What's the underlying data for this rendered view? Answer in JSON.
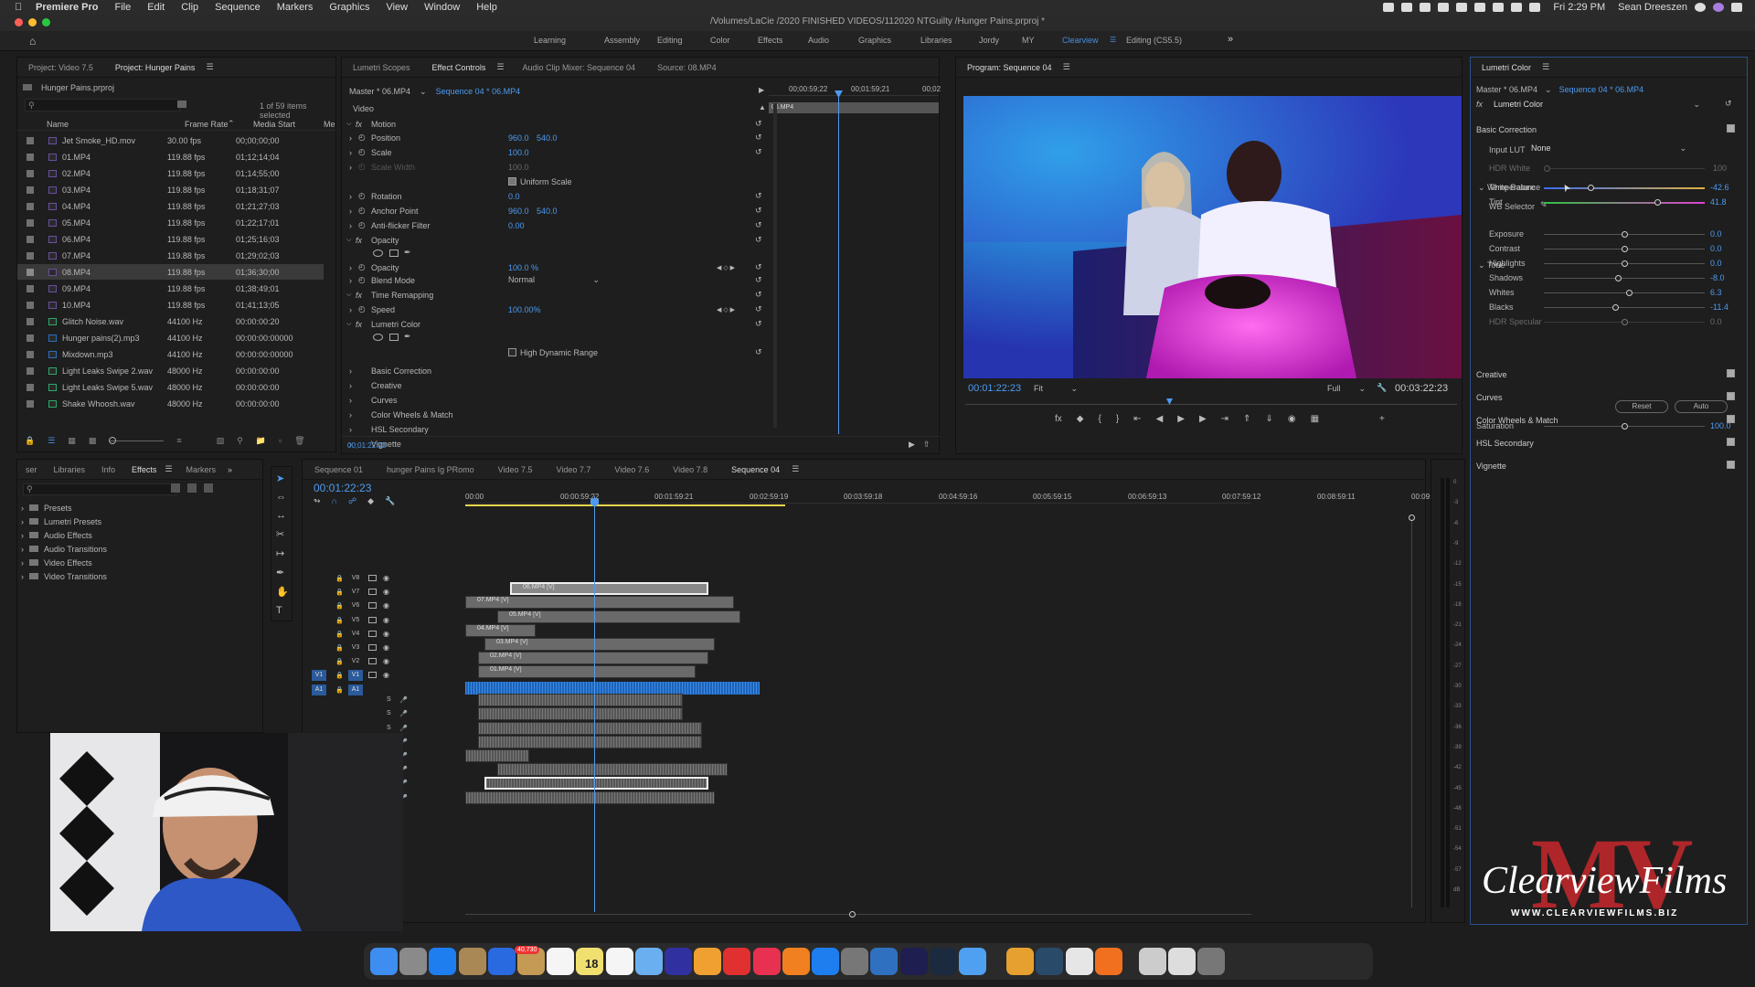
{
  "menubar": {
    "app": "Premiere Pro",
    "items": [
      "File",
      "Edit",
      "Clip",
      "Sequence",
      "Markers",
      "Graphics",
      "View",
      "Window",
      "Help"
    ],
    "clock": "Fri 2:29 PM",
    "user": "Sean Dreeszen"
  },
  "window": {
    "path": "/Volumes/LaCie /2020 FINISHED VIDEOS/112020 NTGuilty /Hunger Pains.prproj *"
  },
  "workspaces": [
    "Learning",
    "Assembly",
    "Editing",
    "Color",
    "Effects",
    "Audio",
    "Graphics",
    "Libraries",
    "Jordy",
    "MY",
    "Clearview",
    "Editing (CS5.5)"
  ],
  "workspace_active": "Clearview",
  "project": {
    "tabs": [
      "Project: Video 7.5",
      "Project: Hunger Pains"
    ],
    "file": "Hunger Pains.prproj",
    "selection": "1 of 59 items selected",
    "columns": [
      "Name",
      "Frame Rate",
      "Media Start",
      "Me"
    ],
    "items": [
      {
        "name": "Jet Smoke_HD.mov",
        "rate": "30.00 fps",
        "start": "00;00;00;00",
        "color": "#6a4fa0"
      },
      {
        "name": "01.MP4",
        "rate": "119.88 fps",
        "start": "01;12;14;04",
        "color": "#6a4fa0"
      },
      {
        "name": "02.MP4",
        "rate": "119.88 fps",
        "start": "01;14;55;00",
        "color": "#6a4fa0"
      },
      {
        "name": "03.MP4",
        "rate": "119.88 fps",
        "start": "01;18;31;07",
        "color": "#6a4fa0"
      },
      {
        "name": "04.MP4",
        "rate": "119.88 fps",
        "start": "01;21;27;03",
        "color": "#6a4fa0"
      },
      {
        "name": "05.MP4",
        "rate": "119.88 fps",
        "start": "01;22;17;01",
        "color": "#6a4fa0"
      },
      {
        "name": "06.MP4",
        "rate": "119.88 fps",
        "start": "01;25;16;03",
        "color": "#6a4fa0"
      },
      {
        "name": "07.MP4",
        "rate": "119.88 fps",
        "start": "01;29;02;03",
        "color": "#6a4fa0"
      },
      {
        "name": "08.MP4",
        "rate": "119.88 fps",
        "start": "01;36;30;00",
        "color": "#6a4fa0"
      },
      {
        "name": "09.MP4",
        "rate": "119.88 fps",
        "start": "01;38;49;01",
        "color": "#6a4fa0"
      },
      {
        "name": "10.MP4",
        "rate": "119.88 fps",
        "start": "01;41;13;05",
        "color": "#6a4fa0"
      },
      {
        "name": "Glitch Noise.wav",
        "rate": "44100 Hz",
        "start": "00:00:00:20",
        "color": "#2ea86a"
      },
      {
        "name": "Hunger pains(2).mp3",
        "rate": "44100 Hz",
        "start": "00:00:00:00000",
        "color": "#2a6fc0"
      },
      {
        "name": "Mixdown.mp3",
        "rate": "44100 Hz",
        "start": "00:00:00:00000",
        "color": "#2a6fc0"
      },
      {
        "name": "Light Leaks Swipe 2.wav",
        "rate": "48000 Hz",
        "start": "00:00:00:00",
        "color": "#2ea86a"
      },
      {
        "name": "Light Leaks Swipe 5.wav",
        "rate": "48000 Hz",
        "start": "00:00:00:00",
        "color": "#2ea86a"
      },
      {
        "name": "Shake Whoosh.wav",
        "rate": "48000 Hz",
        "start": "00:00:00:00",
        "color": "#2ea86a"
      }
    ]
  },
  "effect_controls": {
    "tabs": [
      "Lumetri Scopes",
      "Effect Controls",
      "Audio Clip Mixer: Sequence 04",
      "Source: 08.MP4"
    ],
    "master": "Master * 06.MP4",
    "sequence": "Sequence 04 * 06.MP4",
    "ruler": [
      "00;00:59;22",
      "00;01:59;21",
      "00;02"
    ],
    "clip_label": "06.MP4",
    "section_video": "Video",
    "rows": [
      {
        "label": "Motion",
        "value": "",
        "value2": "",
        "fx": true
      },
      {
        "label": "Position",
        "value": "960.0",
        "value2": "540.0"
      },
      {
        "label": "Scale",
        "value": "100.0",
        "value2": ""
      },
      {
        "label": "Scale Width",
        "value": "100.0",
        "value2": "",
        "dim": true
      },
      {
        "label": "Uniform Scale",
        "value": "",
        "value2": "",
        "check": true
      },
      {
        "label": "Rotation",
        "value": "0.0",
        "value2": ""
      },
      {
        "label": "Anchor Point",
        "value": "960.0",
        "value2": "540.0"
      },
      {
        "label": "Anti-flicker Filter",
        "value": "0.00",
        "value2": ""
      },
      {
        "label": "Opacity",
        "value": "",
        "value2": "",
        "fx": true
      },
      {
        "label": "",
        "value": "",
        "value2": "",
        "masks": true
      },
      {
        "label": "Opacity",
        "value": "100.0 %",
        "value2": ""
      },
      {
        "label": "Blend Mode",
        "value": "Normal",
        "value2": "",
        "dropdown": true
      },
      {
        "label": "Time Remapping",
        "value": "",
        "value2": "",
        "fx": true
      },
      {
        "label": "Speed",
        "value": "100.00%",
        "value2": ""
      },
      {
        "label": "Lumetri Color",
        "value": "",
        "value2": "",
        "fx": true
      },
      {
        "label": "",
        "value": "",
        "value2": "",
        "masks": true
      },
      {
        "label": "High Dynamic Range",
        "value": "",
        "value2": "",
        "check": true
      },
      {
        "label": "Basic Correction",
        "value": "",
        "value2": ""
      },
      {
        "label": "Creative",
        "value": "",
        "value2": ""
      },
      {
        "label": "Curves",
        "value": "",
        "value2": ""
      },
      {
        "label": "Color Wheels & Match",
        "value": "",
        "value2": ""
      },
      {
        "label": "HSL Secondary",
        "value": "",
        "value2": ""
      },
      {
        "label": "Vignette",
        "value": "",
        "value2": ""
      }
    ],
    "timecode": "00;01:22:23"
  },
  "program": {
    "title": "Program: Sequence 04",
    "timecode": "00:01:22:23",
    "fit": "Fit",
    "quality": "Full",
    "duration": "00:03:22:23"
  },
  "lumetri": {
    "title": "Lumetri Color",
    "master": "Master * 06.MP4",
    "sequence": "Sequence 04 * 06.MP4",
    "effect": "Lumetri Color",
    "basic": "Basic Correction",
    "input_lut_label": "Input LUT",
    "input_lut": "None",
    "hdr_white_label": "HDR White",
    "hdr_white": "100",
    "wb": "White Balance",
    "wb_selector": "WB Selector",
    "tone": "Tone",
    "sliders": [
      {
        "label": "Temperature",
        "value": "-42.6",
        "pos": 0.28,
        "kind": "temp"
      },
      {
        "label": "Tint",
        "value": "41.8",
        "pos": 0.71,
        "kind": "tint"
      },
      {
        "label": "Exposure",
        "value": "0.0",
        "pos": 0.5
      },
      {
        "label": "Contrast",
        "value": "0.0",
        "pos": 0.5
      },
      {
        "label": "Highlights",
        "value": "0.0",
        "pos": 0.5
      },
      {
        "label": "Shadows",
        "value": "-8.0",
        "pos": 0.46
      },
      {
        "label": "Whites",
        "value": "6.3",
        "pos": 0.53
      },
      {
        "label": "Blacks",
        "value": "-11.4",
        "pos": 0.44
      },
      {
        "label": "HDR Specular",
        "value": "0.0",
        "pos": 0.5,
        "dim": true
      }
    ],
    "reset": "Reset",
    "auto": "Auto",
    "saturation_label": "Saturation",
    "saturation": "100.0",
    "sections": [
      "Creative",
      "Curves",
      "Color Wheels & Match",
      "HSL Secondary",
      "Vignette"
    ]
  },
  "effects_panel": {
    "tabs": [
      "ser",
      "Libraries",
      "Info",
      "Effects",
      "Markers"
    ],
    "items": [
      "Presets",
      "Lumetri Presets",
      "Audio Effects",
      "Audio Transitions",
      "Video Effects",
      "Video Transitions"
    ]
  },
  "timeline": {
    "tabs": [
      "Sequence 01",
      "hunger Pains Ig PRomo",
      "Video 7.5",
      "Video 7.7",
      "Video 7.6",
      "Video 7.8",
      "Sequence 04"
    ],
    "timecode": "00:01:22:23",
    "ruler": [
      "00:00",
      "00:00:59:22",
      "00:01:59:21",
      "00:02:59:19",
      "00:03:59:18",
      "00:04:59:16",
      "00:05:59:15",
      "00:06:59:13",
      "00:07:59:12",
      "00:08:59:11",
      "00:09:"
    ],
    "video_tracks": [
      "V8",
      "V7",
      "V6",
      "V5",
      "V4",
      "V3",
      "V2",
      "V1"
    ],
    "audio_tracks": [
      "A1"
    ],
    "clips": [
      {
        "label": "06.MP4 [V]",
        "track": 1,
        "start": 0.07,
        "end": 0.38,
        "selected": true
      },
      {
        "label": "07.MP4 [V]",
        "track": 2,
        "start": 0.0,
        "end": 0.42
      },
      {
        "label": "05.MP4 [V]",
        "track": 3,
        "start": 0.05,
        "end": 0.43
      },
      {
        "label": "04.MP4 [V]",
        "track": 4,
        "start": 0.0,
        "end": 0.11
      },
      {
        "label": "03.MP4 [V]",
        "track": 5,
        "start": 0.03,
        "end": 0.39
      },
      {
        "label": "02.MP4 [V]",
        "track": 6,
        "start": 0.02,
        "end": 0.38
      },
      {
        "label": "01.MP4 [V]",
        "track": 7,
        "start": 0.02,
        "end": 0.36
      }
    ],
    "db_labels": [
      "0",
      "-3",
      "-6",
      "-9",
      "-12",
      "-15",
      "-18",
      "-21",
      "-24",
      "-27",
      "-30",
      "-33",
      "-36",
      "-39",
      "-42",
      "-45",
      "-48",
      "-51",
      "-54",
      "-57",
      "dB"
    ]
  },
  "watermark": {
    "brand": "ClearviewFilms",
    "url": "WWW.CLEARVIEWFILMS.BIZ",
    "monogram": "MV"
  },
  "dock": {
    "badge": "40,730",
    "calendar_day": "18"
  }
}
